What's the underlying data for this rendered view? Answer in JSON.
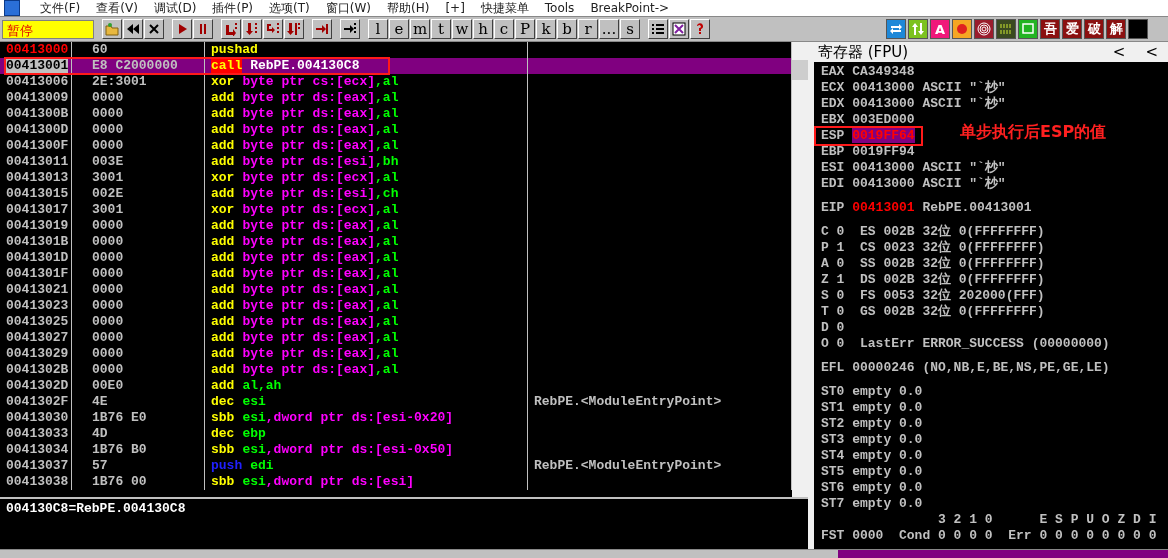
{
  "menu": {
    "items": [
      "文件(F)",
      "查看(V)",
      "调试(D)",
      "插件(P)",
      "选项(T)",
      "窗口(W)",
      "帮助(H)",
      "[+]",
      "快捷菜单",
      "Tools",
      "BreakPoint->"
    ]
  },
  "toolbar": {
    "status": "暂停",
    "groups": [
      [
        {
          "kind": "open"
        },
        {
          "kind": "rewind"
        },
        {
          "kind": "close"
        }
      ],
      [
        {
          "kind": "run"
        },
        {
          "kind": "pause"
        }
      ],
      [
        {
          "kind": "step-into"
        },
        {
          "kind": "step-over"
        },
        {
          "kind": "trace-into"
        },
        {
          "kind": "trace-over"
        }
      ],
      [
        {
          "kind": "return"
        }
      ],
      [
        {
          "kind": "goto"
        }
      ],
      [
        {
          "kind": "letter",
          "label": "l"
        },
        {
          "kind": "letter",
          "label": "e"
        },
        {
          "kind": "letter",
          "label": "m"
        },
        {
          "kind": "letter",
          "label": "t"
        },
        {
          "kind": "letter",
          "label": "w"
        },
        {
          "kind": "letter",
          "label": "h"
        },
        {
          "kind": "letter",
          "label": "c"
        },
        {
          "kind": "letter",
          "label": "P"
        },
        {
          "kind": "letter",
          "label": "k"
        },
        {
          "kind": "letter",
          "label": "b"
        },
        {
          "kind": "letter",
          "label": "r"
        },
        {
          "kind": "letter",
          "label": "..."
        },
        {
          "kind": "letter",
          "label": "s"
        }
      ],
      [
        {
          "kind": "list"
        },
        {
          "kind": "windows"
        },
        {
          "kind": "help"
        }
      ]
    ],
    "plugins": [
      {
        "kind": "swap",
        "color": "#1e88d8"
      },
      {
        "kind": "updown",
        "color": "#7cc21e"
      },
      {
        "kind": "tile",
        "label": "A",
        "color": "#f0187a"
      },
      {
        "kind": "record",
        "color": "#f5a623"
      },
      {
        "kind": "target",
        "color": "#9a1c2c"
      },
      {
        "kind": "binary",
        "color": "#3a4a20"
      },
      {
        "kind": "monitor",
        "color": "#22b422"
      },
      {
        "kind": "tile",
        "label": "吾",
        "color": "#8b1010"
      },
      {
        "kind": "tile",
        "label": "爱",
        "color": "#8b1010"
      },
      {
        "kind": "tile",
        "label": "破",
        "color": "#8b1010"
      },
      {
        "kind": "tile",
        "label": "解",
        "color": "#8b1010"
      },
      {
        "kind": "blank",
        "color": "#000000"
      }
    ]
  },
  "disassembly": {
    "rows": [
      {
        "address": "00413000",
        "hex": "60",
        "mnemonic": "pushad",
        "kind": "plain",
        "operands": [],
        "marked": true,
        "selected": false
      },
      {
        "address": "00413001",
        "hex": "E8 C2000000",
        "mnemonic": "call",
        "kind": "call",
        "operands": [
          {
            "text": "RebPE.004130C8",
            "kind": "label"
          }
        ],
        "marked": false,
        "selected": true
      },
      {
        "address": "00413006",
        "hex": "2E:3001",
        "mnemonic": "xor",
        "kind": "plain",
        "operands": [
          {
            "text": "byte ptr cs:[ecx]",
            "kind": "mem"
          },
          {
            "text": ",al",
            "kind": "reg"
          }
        ],
        "marked": false,
        "selected": false
      },
      {
        "address": "00413009",
        "hex": "0000",
        "mnemonic": "add",
        "kind": "plain",
        "operands": [
          {
            "text": "byte ptr ds:[eax]",
            "kind": "mem"
          },
          {
            "text": ",al",
            "kind": "reg"
          }
        ],
        "marked": false,
        "selected": false
      },
      {
        "address": "0041300B",
        "hex": "0000",
        "mnemonic": "add",
        "kind": "plain",
        "operands": [
          {
            "text": "byte ptr ds:[eax]",
            "kind": "mem"
          },
          {
            "text": ",al",
            "kind": "reg"
          }
        ],
        "marked": false,
        "selected": false
      },
      {
        "address": "0041300D",
        "hex": "0000",
        "mnemonic": "add",
        "kind": "plain",
        "operands": [
          {
            "text": "byte ptr ds:[eax]",
            "kind": "mem"
          },
          {
            "text": ",al",
            "kind": "reg"
          }
        ],
        "marked": false,
        "selected": false
      },
      {
        "address": "0041300F",
        "hex": "0000",
        "mnemonic": "add",
        "kind": "plain",
        "operands": [
          {
            "text": "byte ptr ds:[eax]",
            "kind": "mem"
          },
          {
            "text": ",al",
            "kind": "reg"
          }
        ],
        "marked": false,
        "selected": false
      },
      {
        "address": "00413011",
        "hex": "003E",
        "mnemonic": "add",
        "kind": "plain",
        "operands": [
          {
            "text": "byte ptr ds:[esi]",
            "kind": "mem"
          },
          {
            "text": ",bh",
            "kind": "reg"
          }
        ],
        "marked": false,
        "selected": false
      },
      {
        "address": "00413013",
        "hex": "3001",
        "mnemonic": "xor",
        "kind": "plain",
        "operands": [
          {
            "text": "byte ptr ds:[ecx]",
            "kind": "mem"
          },
          {
            "text": ",al",
            "kind": "reg"
          }
        ],
        "marked": false,
        "selected": false
      },
      {
        "address": "00413015",
        "hex": "002E",
        "mnemonic": "add",
        "kind": "plain",
        "operands": [
          {
            "text": "byte ptr ds:[esi]",
            "kind": "mem"
          },
          {
            "text": ",ch",
            "kind": "reg"
          }
        ],
        "marked": false,
        "selected": false
      },
      {
        "address": "00413017",
        "hex": "3001",
        "mnemonic": "xor",
        "kind": "plain",
        "operands": [
          {
            "text": "byte ptr ds:[ecx]",
            "kind": "mem"
          },
          {
            "text": ",al",
            "kind": "reg"
          }
        ],
        "marked": false,
        "selected": false
      },
      {
        "address": "00413019",
        "hex": "0000",
        "mnemonic": "add",
        "kind": "plain",
        "operands": [
          {
            "text": "byte ptr ds:[eax]",
            "kind": "mem"
          },
          {
            "text": ",al",
            "kind": "reg"
          }
        ],
        "marked": false,
        "selected": false
      },
      {
        "address": "0041301B",
        "hex": "0000",
        "mnemonic": "add",
        "kind": "plain",
        "operands": [
          {
            "text": "byte ptr ds:[eax]",
            "kind": "mem"
          },
          {
            "text": ",al",
            "kind": "reg"
          }
        ],
        "marked": false,
        "selected": false
      },
      {
        "address": "0041301D",
        "hex": "0000",
        "mnemonic": "add",
        "kind": "plain",
        "operands": [
          {
            "text": "byte ptr ds:[eax]",
            "kind": "mem"
          },
          {
            "text": ",al",
            "kind": "reg"
          }
        ],
        "marked": false,
        "selected": false
      },
      {
        "address": "0041301F",
        "hex": "0000",
        "mnemonic": "add",
        "kind": "plain",
        "operands": [
          {
            "text": "byte ptr ds:[eax]",
            "kind": "mem"
          },
          {
            "text": ",al",
            "kind": "reg"
          }
        ],
        "marked": false,
        "selected": false
      },
      {
        "address": "00413021",
        "hex": "0000",
        "mnemonic": "add",
        "kind": "plain",
        "operands": [
          {
            "text": "byte ptr ds:[eax]",
            "kind": "mem"
          },
          {
            "text": ",al",
            "kind": "reg"
          }
        ],
        "marked": false,
        "selected": false
      },
      {
        "address": "00413023",
        "hex": "0000",
        "mnemonic": "add",
        "kind": "plain",
        "operands": [
          {
            "text": "byte ptr ds:[eax]",
            "kind": "mem"
          },
          {
            "text": ",al",
            "kind": "reg"
          }
        ],
        "marked": false,
        "selected": false
      },
      {
        "address": "00413025",
        "hex": "0000",
        "mnemonic": "add",
        "kind": "plain",
        "operands": [
          {
            "text": "byte ptr ds:[eax]",
            "kind": "mem"
          },
          {
            "text": ",al",
            "kind": "reg"
          }
        ],
        "marked": false,
        "selected": false
      },
      {
        "address": "00413027",
        "hex": "0000",
        "mnemonic": "add",
        "kind": "plain",
        "operands": [
          {
            "text": "byte ptr ds:[eax]",
            "kind": "mem"
          },
          {
            "text": ",al",
            "kind": "reg"
          }
        ],
        "marked": false,
        "selected": false
      },
      {
        "address": "00413029",
        "hex": "0000",
        "mnemonic": "add",
        "kind": "plain",
        "operands": [
          {
            "text": "byte ptr ds:[eax]",
            "kind": "mem"
          },
          {
            "text": ",al",
            "kind": "reg"
          }
        ],
        "marked": false,
        "selected": false
      },
      {
        "address": "0041302B",
        "hex": "0000",
        "mnemonic": "add",
        "kind": "plain",
        "operands": [
          {
            "text": "byte ptr ds:[eax]",
            "kind": "mem"
          },
          {
            "text": ",al",
            "kind": "reg"
          }
        ],
        "marked": false,
        "selected": false
      },
      {
        "address": "0041302D",
        "hex": "00E0",
        "mnemonic": "add",
        "kind": "plain",
        "operands": [
          {
            "text": "al,ah",
            "kind": "reg"
          }
        ],
        "marked": false,
        "selected": false
      },
      {
        "address": "0041302F",
        "hex": "4E",
        "mnemonic": "dec",
        "kind": "plain",
        "operands": [
          {
            "text": "esi",
            "kind": "reg"
          }
        ],
        "comment": "RebPE.<ModuleEntryPoint>",
        "marked": false,
        "selected": false
      },
      {
        "address": "00413030",
        "hex": "1B76 E0",
        "mnemonic": "sbb",
        "kind": "plain",
        "operands": [
          {
            "text": "esi",
            "kind": "reg"
          },
          {
            "text": ",dword ptr ds:[esi-0x20]",
            "kind": "mem"
          }
        ],
        "marked": false,
        "selected": false
      },
      {
        "address": "00413033",
        "hex": "4D",
        "mnemonic": "dec",
        "kind": "plain",
        "operands": [
          {
            "text": "ebp",
            "kind": "reg"
          }
        ],
        "marked": false,
        "selected": false
      },
      {
        "address": "00413034",
        "hex": "1B76 B0",
        "mnemonic": "sbb",
        "kind": "plain",
        "operands": [
          {
            "text": "esi",
            "kind": "reg"
          },
          {
            "text": ",dword ptr ds:[esi-0x50]",
            "kind": "mem"
          }
        ],
        "marked": false,
        "selected": false
      },
      {
        "address": "00413037",
        "hex": "57",
        "mnemonic": "push",
        "kind": "push",
        "operands": [
          {
            "text": "edi",
            "kind": "reg"
          }
        ],
        "comment": "RebPE.<ModuleEntryPoint>",
        "marked": false,
        "selected": false
      },
      {
        "address": "00413038",
        "hex": "1B76 00",
        "mnemonic": "sbb",
        "kind": "plain",
        "operands": [
          {
            "text": "esi",
            "kind": "reg"
          },
          {
            "text": ",dword ptr ds:[esi]",
            "kind": "mem"
          }
        ],
        "marked": false,
        "selected": false
      }
    ]
  },
  "info_pane": {
    "text": "004130C8=RebPE.004130C8"
  },
  "registers": {
    "title": "寄存器 (FPU)",
    "nav": [
      "<",
      "<"
    ],
    "general": [
      {
        "name": "EAX",
        "value": "CA349348",
        "changed": false,
        "selected": false
      },
      {
        "name": "ECX",
        "value": "00413000",
        "comment": "ASCII \"`杪\"",
        "changed": false,
        "selected": false
      },
      {
        "name": "EDX",
        "value": "00413000",
        "comment": "ASCII \"`杪\"",
        "changed": false,
        "selected": false
      },
      {
        "name": "EBX",
        "value": "003ED000",
        "changed": false,
        "selected": false
      },
      {
        "name": "ESP",
        "value": "0019FF64",
        "changed": true,
        "selected": true,
        "annotated": true
      },
      {
        "name": "EBP",
        "value": "0019FF94",
        "changed": false,
        "selected": false
      },
      {
        "name": "ESI",
        "value": "00413000",
        "comment": "ASCII \"`杪\"",
        "changed": false,
        "selected": false
      },
      {
        "name": "EDI",
        "value": "00413000",
        "comment": "ASCII \"`杪\"",
        "changed": false,
        "selected": false
      }
    ],
    "eip": {
      "name": "EIP",
      "value": "00413001",
      "comment": "RebPE.00413001",
      "changed": true,
      "selected": false
    },
    "flags": [
      "C 0  ES 002B 32位 0(FFFFFFFF)",
      "P 1  CS 0023 32位 0(FFFFFFFF)",
      "A 0  SS 002B 32位 0(FFFFFFFF)",
      "Z 1  DS 002B 32位 0(FFFFFFFF)",
      "S 0  FS 0053 32位 202000(FFF)",
      "T 0  GS 002B 32位 0(FFFFFFFF)",
      "D 0",
      "O 0  LastErr ERROR_SUCCESS (00000000)"
    ],
    "efl": "EFL 00000246 (NO,NB,E,BE,NS,PE,GE,LE)",
    "fpu": [
      "ST0 empty 0.0",
      "ST1 empty 0.0",
      "ST2 empty 0.0",
      "ST3 empty 0.0",
      "ST4 empty 0.0",
      "ST5 empty 0.0",
      "ST6 empty 0.0",
      "ST7 empty 0.0"
    ],
    "fpu_header": "               3 2 1 0      E S P U O Z D I",
    "fst": "FST 0000  Cond 0 0 0 0  Err 0 0 0 0 0 0 0 0"
  },
  "annotation": {
    "note": "单步执行后ESP的值"
  }
}
